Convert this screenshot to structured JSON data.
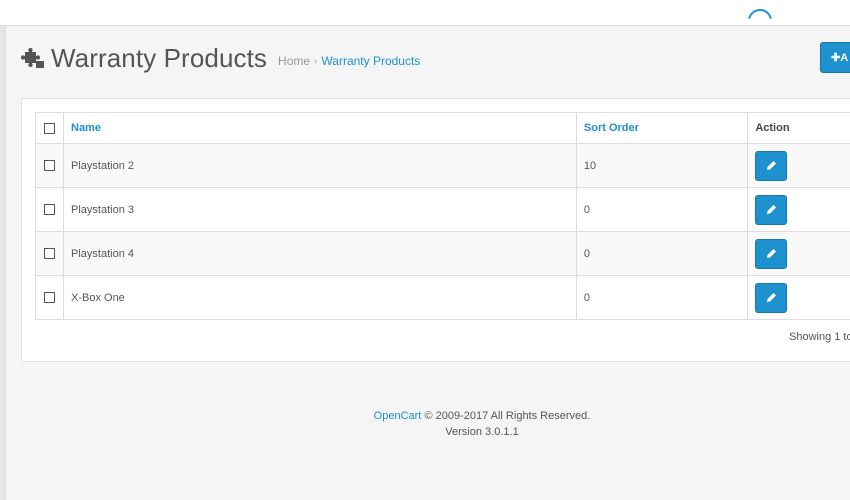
{
  "header": {
    "title": "Warranty Products",
    "icon": "puzzle-icon",
    "breadcrumb": [
      {
        "label": "Home"
      },
      {
        "label": "Warranty Products"
      }
    ],
    "add_button_label": "A"
  },
  "table": {
    "columns": {
      "name": "Name",
      "sort_order": "Sort Order",
      "action": "Action"
    },
    "rows": [
      {
        "name": "Playstation 2",
        "sort_order": "10"
      },
      {
        "name": "Playstation 3",
        "sort_order": "0"
      },
      {
        "name": "Playstation 4",
        "sort_order": "0"
      },
      {
        "name": "X-Box One",
        "sort_order": "0"
      }
    ]
  },
  "pagination": {
    "info": "Showing 1 to"
  },
  "footer": {
    "brand": "OpenCart",
    "copyright": "© 2009-2017 All Rights Reserved.",
    "version": "Version 3.0.1.1"
  },
  "colors": {
    "accent": "#1e91cf",
    "background": "#f5f5f5"
  }
}
